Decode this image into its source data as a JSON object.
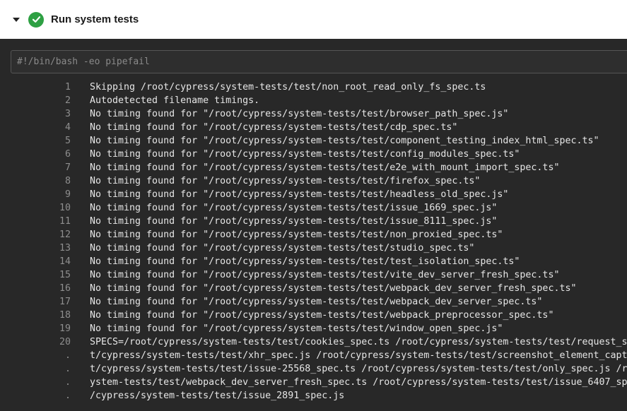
{
  "header": {
    "title": "Run system tests"
  },
  "command": "#!/bin/bash -eo pipefail",
  "lines": [
    {
      "n": "1",
      "t": "Skipping /root/cypress/system-tests/test/non_root_read_only_fs_spec.ts"
    },
    {
      "n": "2",
      "t": "Autodetected filename timings."
    },
    {
      "n": "3",
      "t": "No timing found for \"/root/cypress/system-tests/test/browser_path_spec.js\""
    },
    {
      "n": "4",
      "t": "No timing found for \"/root/cypress/system-tests/test/cdp_spec.ts\""
    },
    {
      "n": "5",
      "t": "No timing found for \"/root/cypress/system-tests/test/component_testing_index_html_spec.ts\""
    },
    {
      "n": "6",
      "t": "No timing found for \"/root/cypress/system-tests/test/config_modules_spec.ts\""
    },
    {
      "n": "7",
      "t": "No timing found for \"/root/cypress/system-tests/test/e2e_with_mount_import_spec.ts\""
    },
    {
      "n": "8",
      "t": "No timing found for \"/root/cypress/system-tests/test/firefox_spec.ts\""
    },
    {
      "n": "9",
      "t": "No timing found for \"/root/cypress/system-tests/test/headless_old_spec.js\""
    },
    {
      "n": "10",
      "t": "No timing found for \"/root/cypress/system-tests/test/issue_1669_spec.js\""
    },
    {
      "n": "11",
      "t": "No timing found for \"/root/cypress/system-tests/test/issue_8111_spec.js\""
    },
    {
      "n": "12",
      "t": "No timing found for \"/root/cypress/system-tests/test/non_proxied_spec.ts\""
    },
    {
      "n": "13",
      "t": "No timing found for \"/root/cypress/system-tests/test/studio_spec.ts\""
    },
    {
      "n": "14",
      "t": "No timing found for \"/root/cypress/system-tests/test/test_isolation_spec.ts\""
    },
    {
      "n": "15",
      "t": "No timing found for \"/root/cypress/system-tests/test/vite_dev_server_fresh_spec.ts\""
    },
    {
      "n": "16",
      "t": "No timing found for \"/root/cypress/system-tests/test/webpack_dev_server_fresh_spec.ts\""
    },
    {
      "n": "17",
      "t": "No timing found for \"/root/cypress/system-tests/test/webpack_dev_server_spec.ts\""
    },
    {
      "n": "18",
      "t": "No timing found for \"/root/cypress/system-tests/test/webpack_preprocessor_spec.ts\""
    },
    {
      "n": "19",
      "t": "No timing found for \"/root/cypress/system-tests/test/window_open_spec.js\""
    },
    {
      "n": "20",
      "t": "SPECS=/root/cypress/system-tests/test/cookies_spec.ts /root/cypress/system-tests/test/request_s"
    },
    {
      "n": ".",
      "t": "t/cypress/system-tests/test/xhr_spec.js /root/cypress/system-tests/test/screenshot_element_capt"
    },
    {
      "n": ".",
      "t": "t/cypress/system-tests/test/issue-25568_spec.ts /root/cypress/system-tests/test/only_spec.js /r"
    },
    {
      "n": ".",
      "t": "ystem-tests/test/webpack_dev_server_fresh_spec.ts /root/cypress/system-tests/test/issue_6407_sp"
    },
    {
      "n": ".",
      "t": "/cypress/system-tests/test/issue_2891_spec.js"
    }
  ]
}
